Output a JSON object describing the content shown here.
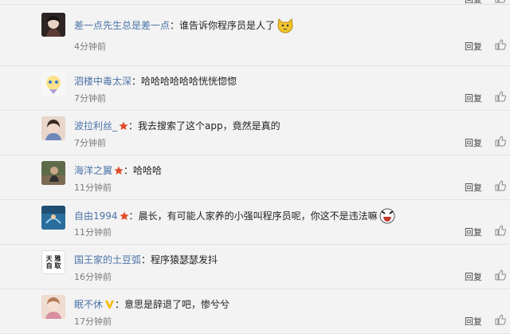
{
  "reply_label": "回复",
  "colors": {
    "username": "#4c73a8",
    "star": "#e14b2b",
    "v_badge": "#f5b800"
  },
  "comments": [
    {
      "user": "差一点先生总是差一点",
      "sep": "：",
      "text": "谁告诉你程序员是人了",
      "time": "4分钟前",
      "emoji": "cat-face-icon"
    },
    {
      "user": "泗楼中毒太深",
      "sep": "：",
      "text": "哈哈哈哈哈哈恍恍惚惚",
      "time": "7分钟前"
    },
    {
      "user": "波拉利丝_",
      "sep": "：",
      "text": "我去搜索了这个app，竟然是真的",
      "time": "7分钟前",
      "badge": "star"
    },
    {
      "user": "海洋之翼",
      "sep": "：",
      "text": "哈哈哈",
      "time": "11分钟前",
      "badge": "star"
    },
    {
      "user": "自由1994",
      "sep": "：",
      "text": "晨长，有可能人家养的小强叫程序员呢，你这不是违法嘛",
      "time": "11分钟前",
      "badge": "star",
      "emoji": "laughing-face-icon"
    },
    {
      "user": "国王家的土豆弧",
      "sep": "：",
      "text": "程序猿瑟瑟发抖",
      "time": "16分钟前",
      "avatar_text": "天 雅 自 取"
    },
    {
      "user": "眠不休",
      "sep": "：",
      "text": "意思是辞退了吧，惨兮兮",
      "time": "17分钟前",
      "badge": "v"
    }
  ]
}
